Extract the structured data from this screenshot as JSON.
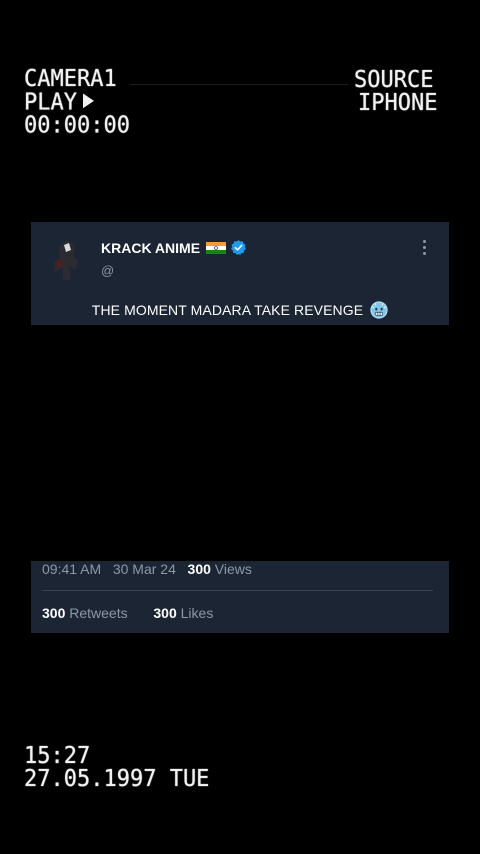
{
  "overlay": {
    "camera": "CAMERA1",
    "play": "PLAY",
    "timecode": "00:00:00",
    "source_label": "SOURCE",
    "source_device": "IPHONE",
    "time": "15:27",
    "date": "27.05.1997 TUE"
  },
  "tweet": {
    "name": "KRACK ANIME",
    "handle": "@",
    "text": "THE MOMENT MADARA TAKE REVENGE",
    "emoji": "cold-face-emoji",
    "time": "09:41 AM",
    "date": "30 Mar 24",
    "views_count": "300",
    "views_label": "Views",
    "retweets_count": "300",
    "retweets_label": "Retweets",
    "likes_count": "300",
    "likes_label": "Likes"
  },
  "colors": {
    "background": "#000000",
    "card": "#1c2533",
    "muted_text": "#8b98a5",
    "verified": "#1d9bf0"
  }
}
